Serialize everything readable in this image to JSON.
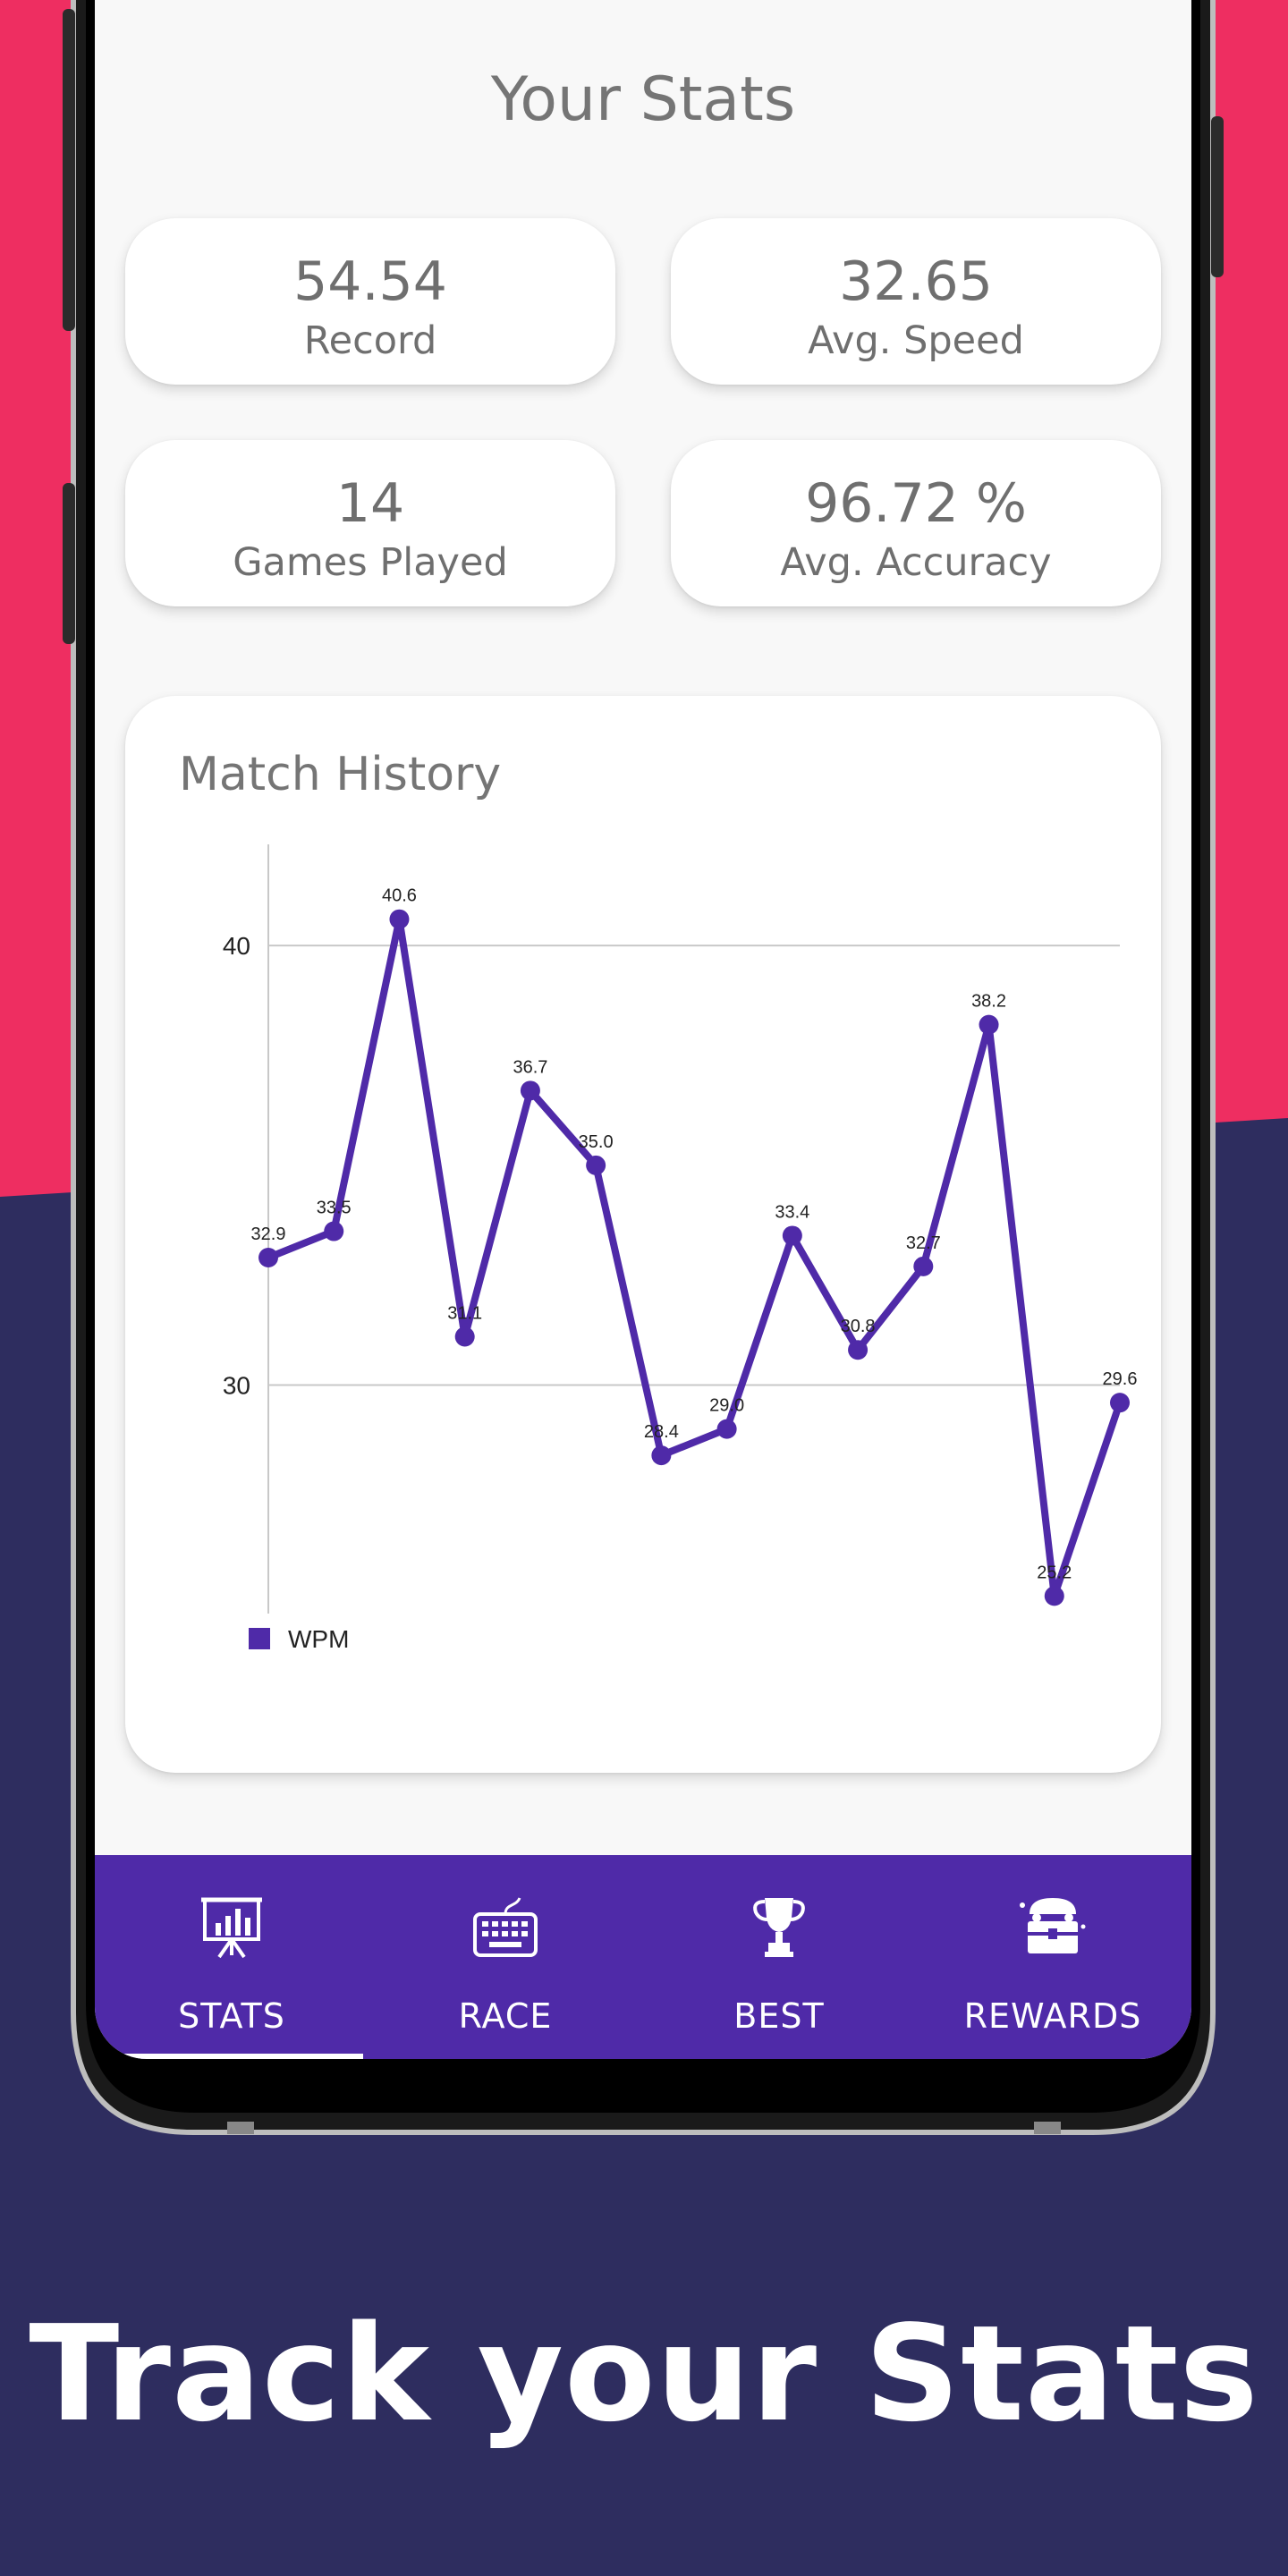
{
  "colors": {
    "pink": "#ee2e61",
    "navy": "#2e2d5f",
    "accent": "#4f2aa8",
    "series": "#4f2aa8"
  },
  "screen": {
    "title": "Your Stats",
    "stats": [
      {
        "value": "54.54",
        "label": "Record"
      },
      {
        "value": "32.65",
        "label": "Avg. Speed"
      },
      {
        "value": "14",
        "label": "Games Played"
      },
      {
        "value": "96.72 %",
        "label": "Avg. Accuracy"
      }
    ],
    "match_history_title": "Match History"
  },
  "chart_data": {
    "type": "line",
    "title": "Match History",
    "series": [
      {
        "name": "WPM",
        "values": [
          32.9,
          33.5,
          40.6,
          31.1,
          36.7,
          35.0,
          28.4,
          29.0,
          33.4,
          30.8,
          32.7,
          38.2,
          25.2,
          29.6
        ]
      }
    ],
    "y_ticks": [
      "30",
      "40"
    ],
    "ylim": [
      24.8,
      42.1
    ],
    "grid": true,
    "legend": "bottom-left"
  },
  "nav": {
    "items": [
      {
        "label": "STATS",
        "icon": "presentation-chart-icon",
        "active": true
      },
      {
        "label": "RACE",
        "icon": "keyboard-icon",
        "active": false
      },
      {
        "label": "BEST",
        "icon": "trophy-icon",
        "active": false
      },
      {
        "label": "REWARDS",
        "icon": "treasure-chest-icon",
        "active": false
      }
    ]
  },
  "caption": "Track your Stats"
}
